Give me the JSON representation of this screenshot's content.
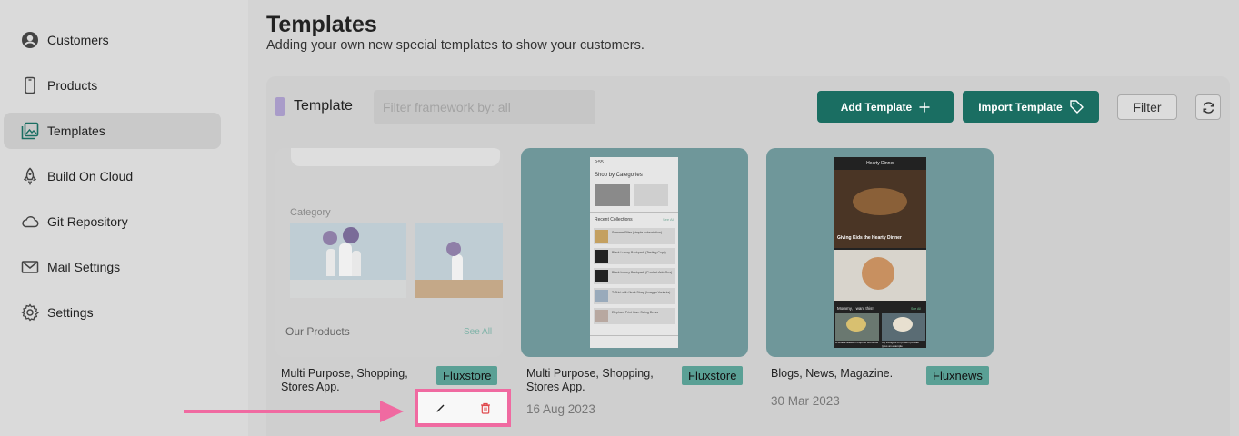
{
  "sidebar": {
    "items": [
      {
        "label": "Customers",
        "icon": "user-circle-icon"
      },
      {
        "label": "Products",
        "icon": "phone-icon"
      },
      {
        "label": "Templates",
        "icon": "image-stack-icon",
        "active": true
      },
      {
        "label": "Build On Cloud",
        "icon": "rocket-icon"
      },
      {
        "label": "Git Repository",
        "icon": "cloud-icon"
      },
      {
        "label": "Mail Settings",
        "icon": "mail-icon"
      },
      {
        "label": "Settings",
        "icon": "gear-icon"
      }
    ]
  },
  "header": {
    "title": "Templates",
    "subtitle": "Adding your own new special templates to show your customers."
  },
  "toolbar": {
    "section_title": "Template",
    "filter_placeholder": "Filter framework by: all",
    "add_label": "Add Template",
    "import_label": "Import Template",
    "filter_label": "Filter"
  },
  "cards": [
    {
      "name": "Multi Purpose, Shopping, Stores App.",
      "badge": "Fluxstore",
      "date": "",
      "preview": {
        "category": "Category",
        "products": "Our Products",
        "see_all": "See All"
      }
    },
    {
      "name": "Multi Purpose, Shopping, Stores App.",
      "badge": "Fluxstore",
      "date": "16 Aug 2023",
      "preview": {
        "time": "9:55",
        "heading": "Shop by Categories",
        "recent": "Recent Collections",
        "see_all": "See All",
        "items": [
          "Summer Filter (simple subscription)",
          "Black Luxury Backpack (Testing Copy)",
          "Black Luxury Backpack (Product Add-Ons)",
          "T-Shirt with Neck Strap (Imagga Variants)",
          "Elephant Print Cam Swing Dress"
        ]
      }
    },
    {
      "name": "Blogs, News, Magazine.",
      "badge": "Fluxnews",
      "date": "30 Mar 2023",
      "preview": {
        "title": "Hearty Dinner",
        "caption": "Giving Kids the Hearty Dinner",
        "section": "Mommy, I want this!",
        "see_all": "See All",
        "posts": [
          "A Middle Eastern Inspired Hummus",
          "My thoughts on protein powder (plus an example"
        ]
      }
    }
  ],
  "actions": {
    "edit_icon": "pencil-icon",
    "delete_icon": "trash-icon"
  },
  "colors": {
    "primary": "#1a6e62",
    "badge": "#5aa095",
    "highlight": "#f06aa1",
    "teal_card": "#6f979a"
  }
}
